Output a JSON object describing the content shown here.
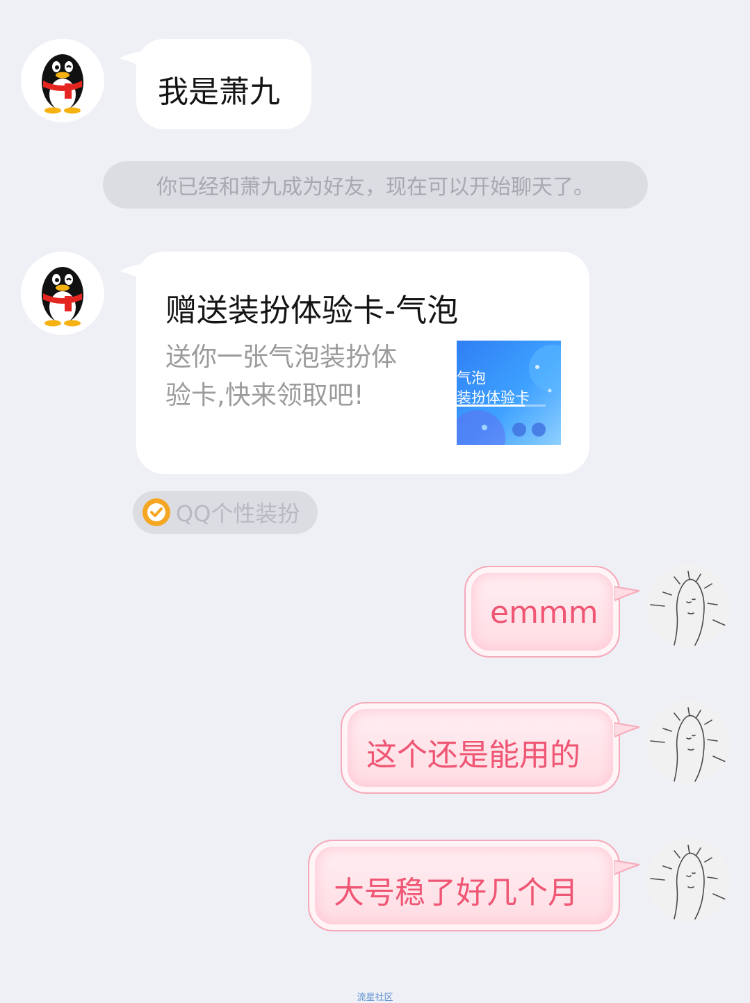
{
  "messages": {
    "m1": {
      "sender_avatar": "qq-penguin-avatar",
      "text": "我是萧九"
    },
    "system": {
      "text": "你已经和萧九成为好友，现在可以开始聊天了。"
    },
    "card": {
      "title": "赠送装扮体验卡-气泡",
      "desc_line1": "送你一张气泡装扮体",
      "desc_line2": "验卡,快来领取吧!",
      "thumb_line1": "气泡",
      "thumb_line2": "装扮体验卡",
      "source_label": "QQ个性装扮",
      "source_icon": "verified-badge-icon"
    },
    "out1": {
      "text": "emmm"
    },
    "out2": {
      "text": "这个还是能用的"
    },
    "out3": {
      "text": "大号稳了好几个月"
    }
  },
  "watermark": "流星社区",
  "colors": {
    "background": "#eff0f6",
    "outgoing_text": "#ef5674",
    "outgoing_border": "#f6a9b9",
    "system_pill": "#dcdde3",
    "verified_badge": "#f5a623"
  }
}
